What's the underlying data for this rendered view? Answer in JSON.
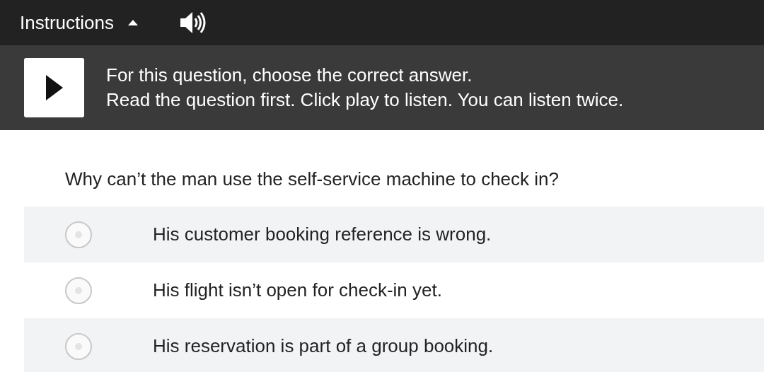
{
  "toolbar": {
    "title": "Instructions",
    "expanded": true
  },
  "instructions": {
    "lines": [
      "For this question, choose the correct answer.",
      "Read the question first. Click play to listen. You can listen twice."
    ]
  },
  "question": "Why can’t the man use the self-service machine to check in?",
  "options": [
    {
      "text": "His customer booking reference is wrong.",
      "selected": false
    },
    {
      "text": "His flight isn’t open for check-in yet.",
      "selected": false
    },
    {
      "text": "His reservation is part of a group booking.",
      "selected": false
    }
  ]
}
